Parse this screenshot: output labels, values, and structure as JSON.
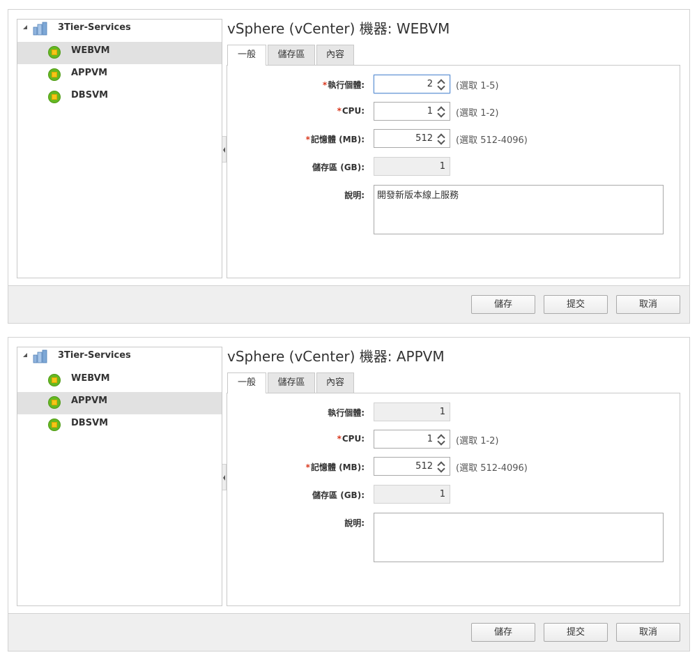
{
  "panels": [
    {
      "tree": {
        "root_label": "3Tier-Services",
        "items": [
          {
            "label": "WEBVM",
            "selected": true
          },
          {
            "label": "APPVM",
            "selected": false
          },
          {
            "label": "DBSVM",
            "selected": false
          }
        ]
      },
      "title": "vSphere (vCenter) 機器: WEBVM",
      "tabs": [
        "一般",
        "儲存區",
        "內容"
      ],
      "fields": {
        "instances": {
          "label": "執行個體:",
          "value": "2",
          "hint": "(選取 1-5)"
        },
        "cpu": {
          "label": "CPU:",
          "value": "1",
          "hint": "(選取 1-2)"
        },
        "memory": {
          "label": "記憶體 (MB):",
          "value": "512",
          "hint": "(選取 512-4096)"
        },
        "storage": {
          "label": "儲存區 (GB):",
          "value": "1"
        },
        "description": {
          "label": "說明:",
          "value": "開發新版本線上服務"
        }
      },
      "buttons": {
        "save": "儲存",
        "submit": "提交",
        "cancel": "取消"
      }
    },
    {
      "tree": {
        "root_label": "3Tier-Services",
        "items": [
          {
            "label": "WEBVM",
            "selected": false
          },
          {
            "label": "APPVM",
            "selected": true
          },
          {
            "label": "DBSVM",
            "selected": false
          }
        ]
      },
      "title": "vSphere (vCenter) 機器: APPVM",
      "tabs": [
        "一般",
        "儲存區",
        "內容"
      ],
      "fields": {
        "instances": {
          "label": "執行個體:",
          "value": "1"
        },
        "cpu": {
          "label": "CPU:",
          "value": "1",
          "hint": "(選取 1-2)"
        },
        "memory": {
          "label": "記憶體 (MB):",
          "value": "512",
          "hint": "(選取 512-4096)"
        },
        "storage": {
          "label": "儲存區 (GB):",
          "value": "1"
        },
        "description": {
          "label": "說明:",
          "value": ""
        }
      },
      "buttons": {
        "save": "儲存",
        "submit": "提交",
        "cancel": "取消"
      }
    }
  ],
  "required_marker": "*",
  "colors": {
    "required": "#d9381e",
    "vm_icon": "#66b821",
    "selected_row": "#e1e1e1"
  },
  "icons": {
    "root": "vapp-icon",
    "item": "vm-icon",
    "expand": "expand-triangle-icon"
  }
}
